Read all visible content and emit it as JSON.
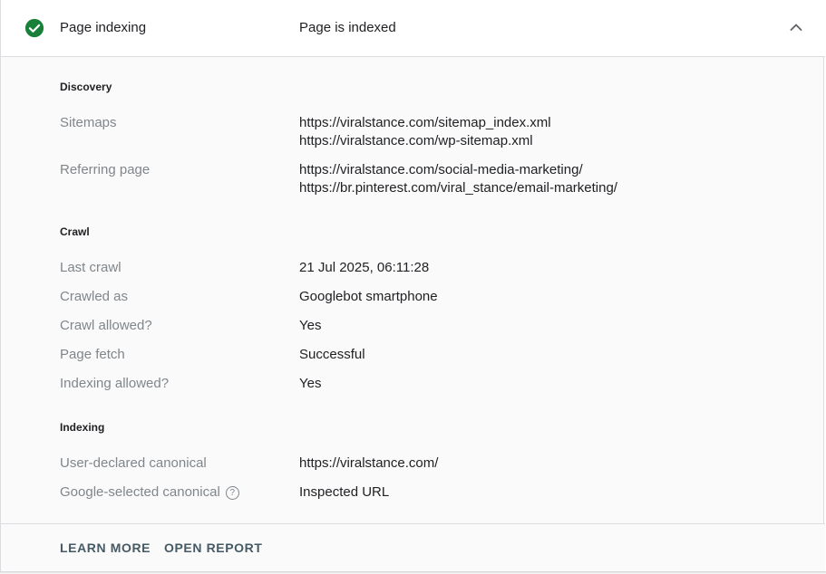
{
  "header": {
    "title": "Page indexing",
    "status": "Page is indexed",
    "status_icon": "check-circle-icon",
    "accent_color": "#188038",
    "collapse_icon": "chevron-up-icon"
  },
  "discovery": {
    "title": "Discovery",
    "sitemaps_label": "Sitemaps",
    "sitemaps": [
      "https://viralstance.com/sitemap_index.xml",
      "https://viralstance.com/wp-sitemap.xml"
    ],
    "referring_label": "Referring page",
    "referring": [
      "https://viralstance.com/social-media-marketing/",
      "https://br.pinterest.com/viral_stance/email-marketing/"
    ]
  },
  "crawl": {
    "title": "Crawl",
    "rows": [
      {
        "label": "Last crawl",
        "value": "21 Jul 2025, 06:11:28"
      },
      {
        "label": "Crawled as",
        "value": "Googlebot smartphone"
      },
      {
        "label": "Crawl allowed?",
        "value": "Yes"
      },
      {
        "label": "Page fetch",
        "value": "Successful"
      },
      {
        "label": "Indexing allowed?",
        "value": "Yes"
      }
    ]
  },
  "indexing": {
    "title": "Indexing",
    "user_canonical_label": "User-declared canonical",
    "user_canonical_value": "https://viralstance.com/",
    "google_canonical_label": "Google-selected canonical",
    "google_canonical_value": "Inspected URL",
    "help_icon": "help-circle-icon",
    "help_glyph": "?"
  },
  "footer": {
    "learn_more": "LEARN MORE",
    "open_report": "OPEN REPORT"
  }
}
